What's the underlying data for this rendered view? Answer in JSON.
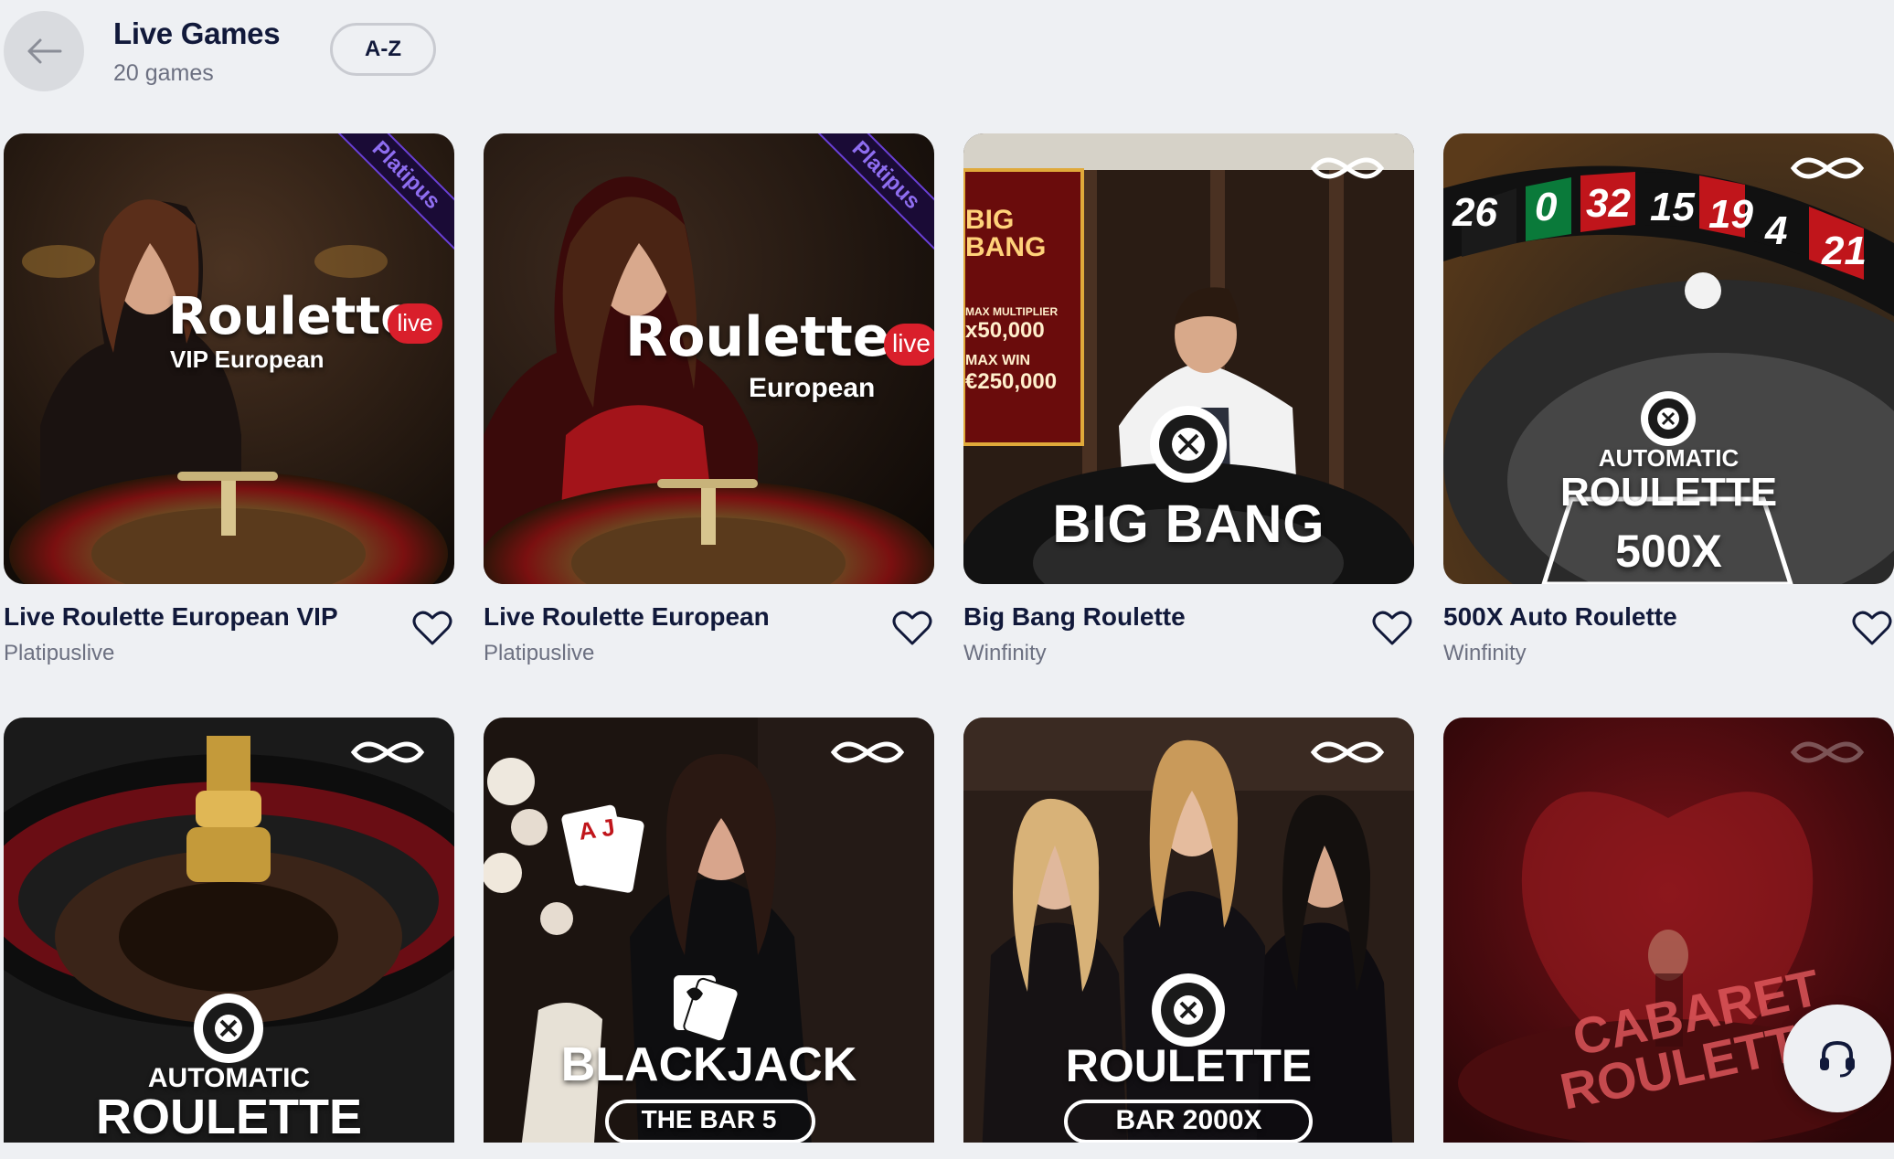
{
  "header": {
    "title": "Live Games",
    "subtitle": "20 games",
    "sort_label": "A-Z"
  },
  "games": [
    {
      "name": "Live Roulette European VIP",
      "provider": "Platipuslive",
      "art_title": "Roulette",
      "art_badge": "live",
      "art_sub": "VIP European",
      "ribbon": "Platipus"
    },
    {
      "name": "Live Roulette European",
      "provider": "Platipuslive",
      "art_title": "Roulette",
      "art_badge": "live",
      "art_sub": "European",
      "ribbon": "Platipus"
    },
    {
      "name": "Big Bang Roulette",
      "provider": "Winfinity",
      "art_title": "BIG BANG",
      "art_sign": "BIG BANG",
      "art_sign_lines": [
        "MAX MULTIPLIER",
        "x50,000",
        "MAX WIN",
        "€250,000"
      ]
    },
    {
      "name": "500X Auto Roulette",
      "provider": "Winfinity",
      "art_top": "AUTOMATIC",
      "art_title": "ROULETTE",
      "art_sub": "500X",
      "wheel_numbers": [
        "26",
        "0",
        "32",
        "15",
        "19",
        "4",
        "21"
      ]
    },
    {
      "art_top": "AUTOMATIC",
      "art_title": "ROULETTE"
    },
    {
      "art_title": "BLACKJACK",
      "art_sub": "THE BAR 5",
      "cards": "A J"
    },
    {
      "art_title": "ROULETTE",
      "art_sub": "BAR 2000X"
    },
    {
      "art_title": "CABARET",
      "art_title2": "ROULETTE"
    }
  ],
  "icons": {
    "back": "arrow-left-icon",
    "favorite": "heart-outline-icon",
    "provider_logo": "infinity-icon",
    "support": "headset-icon"
  },
  "colors": {
    "background": "#eef0f3",
    "text_primary": "#11193a",
    "text_secondary": "#6c7081",
    "live_badge": "#d91f2b",
    "ribbon_text": "#8e6df0"
  }
}
